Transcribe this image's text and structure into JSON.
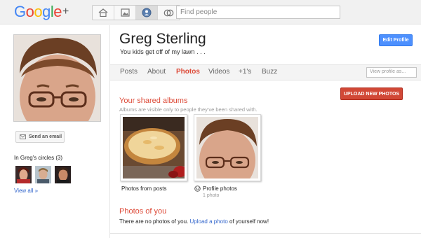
{
  "logo": {
    "text": "Google",
    "plus": "+"
  },
  "nav": {
    "icons": [
      "home-icon",
      "photos-icon",
      "profile-icon",
      "circles-icon"
    ],
    "active": "profile-icon"
  },
  "search": {
    "placeholder": "Find people"
  },
  "profile": {
    "name": "Greg Sterling",
    "tagline": "You kids get off of my lawn . . .",
    "edit_label": "Edit Profile"
  },
  "sidebar": {
    "send_email_label": "Send an email",
    "circles_title": "In Greg's circles (3)",
    "view_all_label": "View all »"
  },
  "tabs": [
    {
      "label": "Posts",
      "active": false
    },
    {
      "label": "About",
      "active": false
    },
    {
      "label": "Photos",
      "active": true
    },
    {
      "label": "Videos",
      "active": false
    },
    {
      "label": "+1's",
      "active": false
    },
    {
      "label": "Buzz",
      "active": false
    }
  ],
  "view_profile": {
    "placeholder": "View profile as..."
  },
  "albums": {
    "upload_label": "UPLOAD NEW PHOTOS",
    "title": "Your shared albums",
    "subtitle": "Albums are visible only to people they've been shared with.",
    "items": [
      {
        "name": "Photos from posts",
        "count": ""
      },
      {
        "name": "Profile photos",
        "count": "1 photo"
      }
    ]
  },
  "photos_of_you": {
    "title": "Photos of you",
    "message_pre": "There are no photos of you.",
    "link": "Upload a photo",
    "message_post": "of yourself now!"
  },
  "colors": {
    "accent_red": "#dd4b39",
    "button_blue": "#4d90fe",
    "link_blue": "#3366cc"
  }
}
